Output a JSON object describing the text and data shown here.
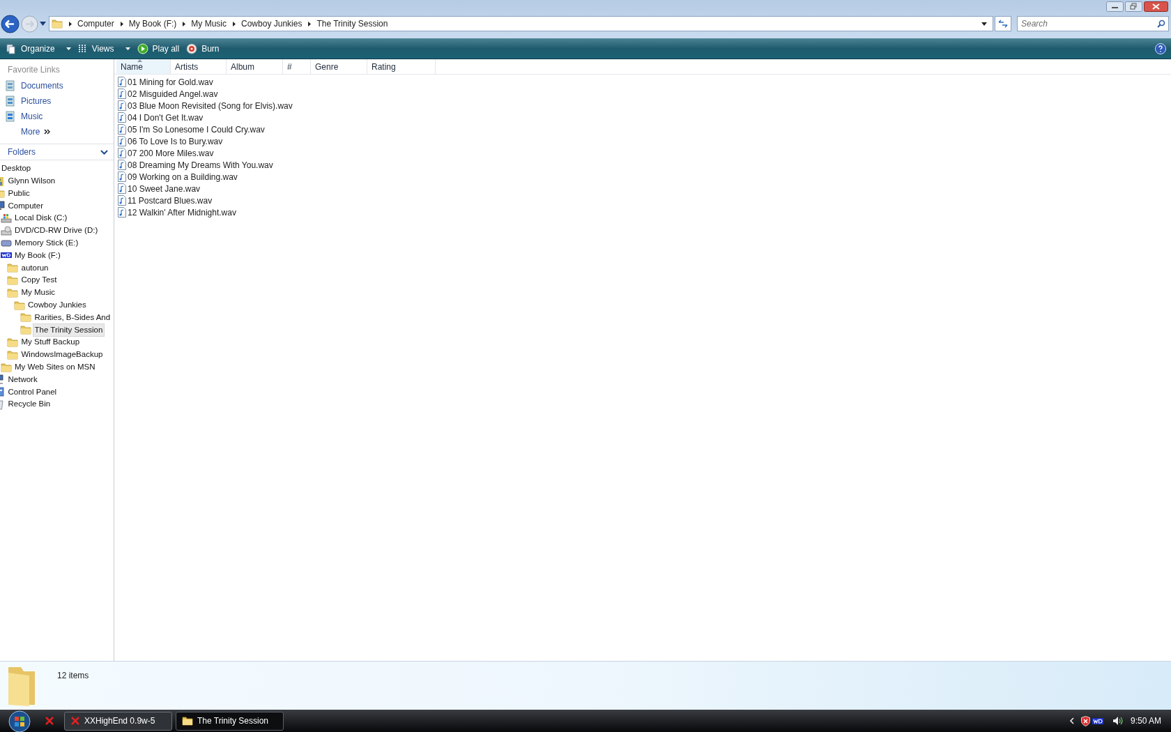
{
  "address": {
    "crumbs": [
      "Computer",
      "My Book (F:)",
      "My Music",
      "Cowboy Junkies",
      "The Trinity Session"
    ]
  },
  "search": {
    "placeholder": "Search"
  },
  "toolbar": [
    {
      "label": "Organize",
      "kind": "organize",
      "menu": true
    },
    {
      "label": "Views",
      "kind": "views",
      "menu": true
    },
    {
      "label": "Play all",
      "kind": "play",
      "menu": false
    },
    {
      "label": "Burn",
      "kind": "burn",
      "menu": false
    }
  ],
  "favorites": {
    "title": "Favorite Links",
    "items": [
      {
        "label": "Documents",
        "kind": "documents"
      },
      {
        "label": "Pictures",
        "kind": "pictures"
      },
      {
        "label": "Music",
        "kind": "music"
      }
    ],
    "more": "More"
  },
  "folders": {
    "title": "Folders",
    "expanded": true
  },
  "tree": [
    {
      "label": "Desktop",
      "selected": false,
      "children": [
        {
          "label": "Glynn Wilson",
          "kind": "user",
          "selected": false
        },
        {
          "label": "Public",
          "kind": "folder",
          "selected": false
        },
        {
          "label": "Computer",
          "kind": "computer",
          "selected": false,
          "children": [
            {
              "label": "Local Disk (C:)",
              "kind": "disk",
              "selected": false
            },
            {
              "label": "DVD/CD-RW Drive (D:)",
              "kind": "dvd",
              "selected": false
            },
            {
              "label": "Memory Stick (E:)",
              "kind": "stick",
              "selected": false
            },
            {
              "label": "My Book (F:)",
              "kind": "wd",
              "selected": false,
              "children": [
                {
                  "label": "autorun",
                  "kind": "folder",
                  "selected": false
                },
                {
                  "label": "Copy Test",
                  "kind": "folder",
                  "selected": false
                },
                {
                  "label": "My Music",
                  "kind": "folder",
                  "selected": false,
                  "children": [
                    {
                      "label": "Cowboy Junkies",
                      "kind": "folder",
                      "selected": false,
                      "children": [
                        {
                          "label": "Rarities, B-Sides And",
                          "kind": "folder",
                          "selected": false
                        },
                        {
                          "label": "The Trinity Session",
                          "kind": "folder",
                          "selected": true
                        }
                      ]
                    }
                  ]
                },
                {
                  "label": "My Stuff Backup",
                  "kind": "folder",
                  "selected": false
                },
                {
                  "label": "WindowsImageBackup",
                  "kind": "folder",
                  "selected": false
                }
              ]
            },
            {
              "label": "My Web Sites on MSN",
              "kind": "folder",
              "selected": false
            }
          ]
        },
        {
          "label": "Network",
          "kind": "network",
          "selected": false
        },
        {
          "label": "Control Panel",
          "kind": "panel",
          "selected": false
        },
        {
          "label": "Recycle Bin",
          "kind": "recycle",
          "selected": false
        }
      ]
    }
  ],
  "columns": [
    {
      "label": "Name",
      "sorted": true
    },
    {
      "label": "Artists",
      "sorted": false
    },
    {
      "label": "Album",
      "sorted": false
    },
    {
      "label": "#",
      "sorted": false
    },
    {
      "label": "Genre",
      "sorted": false
    },
    {
      "label": "Rating",
      "sorted": false
    }
  ],
  "files": [
    "01 Mining for Gold.wav",
    "02 Misguided Angel.wav",
    "03 Blue Moon Revisited (Song for Elvis).wav",
    "04 I Don't Get It.wav",
    "05 I'm So Lonesome I Could Cry.wav",
    "06 To Love Is to Bury.wav",
    "07 200 More Miles.wav",
    "08 Dreaming My Dreams With You.wav",
    "09 Working on a Building.wav",
    "10 Sweet Jane.wav",
    "11 Postcard Blues.wav",
    "12 Walkin' After Midnight.wav"
  ],
  "details": {
    "count": "12 items"
  },
  "taskbar": {
    "tasks": [
      {
        "label": "XXHighEnd 0.9w-5",
        "kind": "x",
        "selected": false
      },
      {
        "label": "The Trinity Session",
        "kind": "folder",
        "selected": true
      }
    ],
    "clock": "9:50 AM"
  }
}
